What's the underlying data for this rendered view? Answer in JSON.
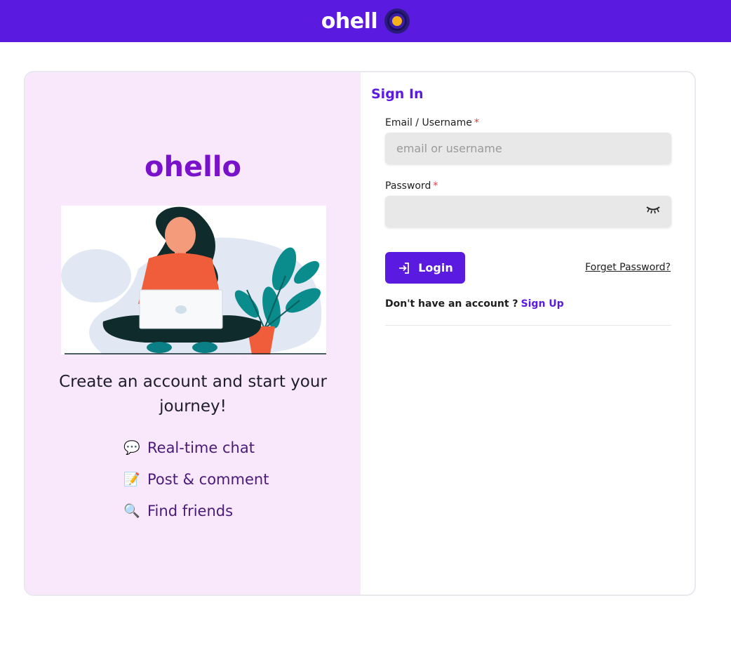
{
  "header": {
    "brand": "ohell",
    "logo_icon": "brand-logo-icon"
  },
  "left_panel": {
    "title": "ohello",
    "tagline": "Create an account and start your journey!",
    "features": [
      {
        "icon": "💬",
        "icon_name": "speech-bubble-icon",
        "label": "Real-time chat"
      },
      {
        "icon": "📝",
        "icon_name": "memo-icon",
        "label": "Post & comment"
      },
      {
        "icon": "🔍",
        "icon_name": "magnifier-icon",
        "label": "Find friends"
      }
    ]
  },
  "form": {
    "title": "Sign In",
    "email_label": "Email / Username",
    "email_placeholder": "email or username",
    "email_value": "",
    "password_label": "Password",
    "password_value": "",
    "required_mark": "*",
    "login_label": "Login",
    "forget_label": "Forget Password?",
    "no_account_text": "Don't have an account ?",
    "signup_label": "Sign Up"
  },
  "colors": {
    "brand_purple": "#5b1ae0",
    "title_purple": "#7a12cc",
    "panel_bg": "#f9e8fc",
    "logo_dot": "#f6b21a",
    "required_red": "#e03b3b"
  }
}
